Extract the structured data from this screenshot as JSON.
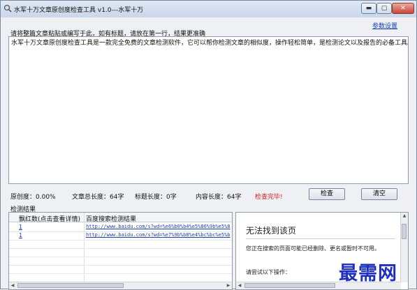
{
  "window": {
    "title": "水军十万文章原创度检查工具  v1.0---水军十万",
    "minimize_glyph": "▬",
    "maximize_glyph": "▢",
    "close_glyph": "✕"
  },
  "settings_link": "参数设置",
  "instruction": "请将整篇文章粘贴或编写于此，如有标题，请放在第一行，结果更准确",
  "article_text": "水军十万文章原创度检查工具是一款完全免费的文章检测软件，它可以帮你检测文章的相似度，操作轻松简单，是检测论文以及报告的必备工具。",
  "stats": {
    "originality": "原创度：0.00%",
    "total_length": "文章总长度：64字",
    "title_length": "标题长度：0字",
    "content_length": "内容长度：64字",
    "status": "检查完毕!"
  },
  "buttons": {
    "check": "检查",
    "clear": "清空"
  },
  "results": {
    "section_label": "检测结果",
    "columns": [
      "飘红数(点击查看详情)",
      "百度搜索检测结果"
    ],
    "rows": [
      [
        "1",
        "http://www.baidu.com/s?wd=%e6%b0%b4%e5%86%9b%e5%8"
      ],
      [
        "1",
        "http://www.baidu.com/s?wd=%e7%9b%b8%e4%bc%bc%e5%b"
      ]
    ]
  },
  "browser": {
    "error_title": "无法找到该页",
    "error_message": "您正在搜索的页面可能已经删除、更名或暂时不可用。",
    "try_text": "请尝试以下操作："
  },
  "watermark": "最需网",
  "colors": {
    "link": "#1a3fb0",
    "status_done": "#d21e1e",
    "watermark": "#1d2fbf"
  },
  "icons": [
    "search-icon",
    "minimize-icon",
    "maximize-icon",
    "close-icon"
  ]
}
